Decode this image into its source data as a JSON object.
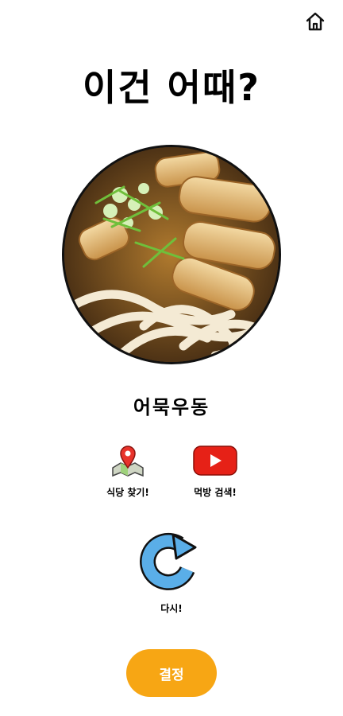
{
  "header": {
    "home_icon": "home-icon"
  },
  "main": {
    "title": "이건 어때?",
    "food_name": "어묵우동",
    "food_image": "udon-with-fishcake-photo"
  },
  "actions": {
    "map_label": "식당 찾기!",
    "map_icon": "map-pin-icon",
    "youtube_label": "먹방 검색!",
    "youtube_icon": "youtube-play-icon",
    "retry_label": "다시!",
    "retry_icon": "refresh-arrow-icon"
  },
  "footer": {
    "confirm_label": "결정"
  },
  "colors": {
    "accent": "#f7a614",
    "youtube_red": "#e62117",
    "retry_blue": "#5aaee8"
  }
}
